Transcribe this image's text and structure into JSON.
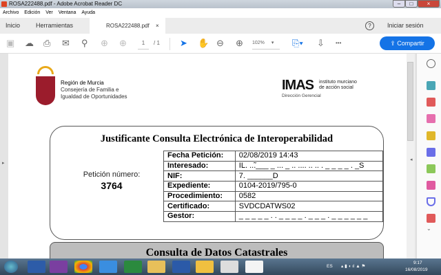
{
  "window": {
    "title": "ROSA222488.pdf - Adobe Acrobat Reader DC"
  },
  "menu": [
    "Archivo",
    "Edición",
    "Ver",
    "Ventana",
    "Ayuda"
  ],
  "tabs": {
    "home": "Inicio",
    "tools": "Herramientas",
    "document": "ROSA222488.pdf",
    "close": "×",
    "signin": "Iniciar sesión",
    "help": "?"
  },
  "toolbar": {
    "page_current": "1",
    "page_total": "/ 1",
    "zoom": "102%",
    "share": "Compartir",
    "more": "•••"
  },
  "doc": {
    "org1": {
      "line1": "Región de Murcia",
      "line2": "Consejería de Familia e",
      "line3": "Igualdad de Oportunidades"
    },
    "org2": {
      "logo": "IMAS",
      "line1": "instituto murciano",
      "line2": "de acción social",
      "line3": "Dirección Gerencial"
    },
    "title": "Justificante Consulta Electrónica de Interoperabilidad",
    "peticion_label": "Petición número:",
    "peticion_num": "3764",
    "rows": [
      {
        "label": "Fecha Petición:",
        "value": "02/08/2019 14:43"
      },
      {
        "label": "Interesado:",
        "value": "IL. ..̃.___ _ ... _ .. .... .. .. . _ _ _ _ . _S"
      },
      {
        "label": "NIF:",
        "value": "7. ______D"
      },
      {
        "label": "Expediente:",
        "value": "0104-2019/795-0"
      },
      {
        "label": "Procedimiento:",
        "value": "0582"
      },
      {
        "label": "Certificado:",
        "value": "SVDCDATWS02"
      },
      {
        "label": "Gestor:",
        "value": "_ _ _ _ _ . . _ _ _ _ . _ _ _ . _ _ _ _ _ _"
      }
    ],
    "section2_title": "Consulta de Datos Catastrales"
  },
  "taskbar": {
    "lang": "ES",
    "time": "9:17",
    "date": "16/08/2019"
  }
}
